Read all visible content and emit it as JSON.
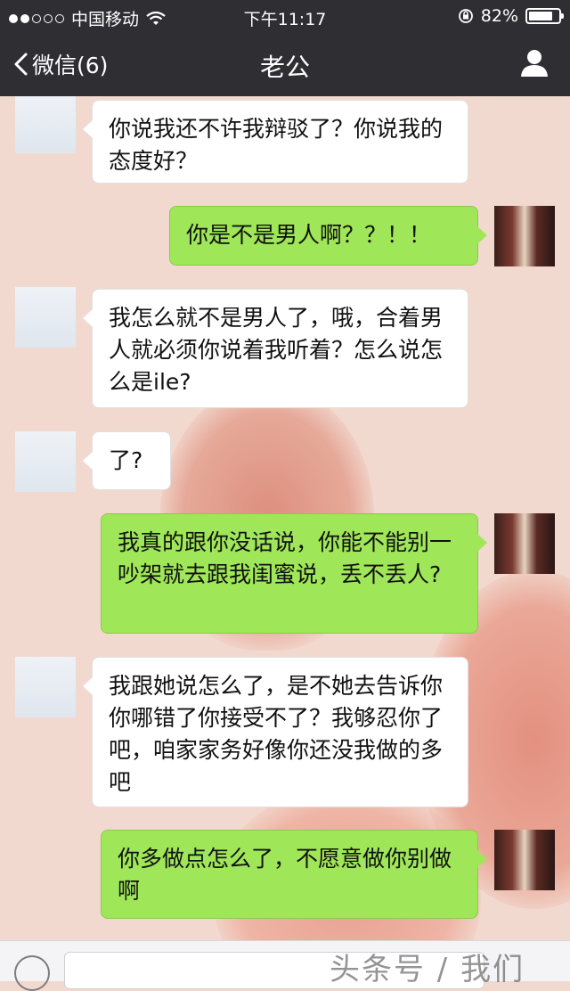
{
  "status_bar": {
    "carrier": "中国移动",
    "time": "下午11:17",
    "battery": "82%",
    "battery_level": 0.82
  },
  "nav": {
    "back_label": "微信(6)",
    "title": "老公"
  },
  "messages": [
    {
      "from": "her",
      "text": "你说我还不许我辩驳了？你说我的态度好？"
    },
    {
      "from": "me",
      "text": "你是不是男人啊？？！！"
    },
    {
      "from": "her",
      "text": "我怎么就不是男人了，哦，合着男人就必须你说着我听着？怎么说怎么是ile?"
    },
    {
      "from": "her",
      "text": "了?"
    },
    {
      "from": "me",
      "text": "我真的跟你没话说，你能不能别一吵架就去跟我闺蜜说，丢不丢人?"
    },
    {
      "from": "her",
      "text": "我跟她说怎么了，是不她去告诉你你哪错了你接受不了？我够忍你了吧，咱家家务好像你还没我做的多吧"
    },
    {
      "from": "me",
      "text": "你多做点怎么了，不愿意做你别做啊"
    }
  ],
  "watermark": "头条号 / 我们",
  "colors": {
    "nav_bg": "#2e2e33",
    "my_bubble": "#9fe658",
    "their_bubble": "#ffffff",
    "chat_bg": "#f2d9cf"
  }
}
